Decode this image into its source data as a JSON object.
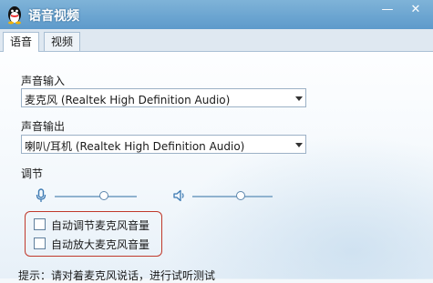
{
  "window": {
    "title": "语音视频",
    "minimize_glyph": "—",
    "close_glyph": "✕"
  },
  "tabs": [
    {
      "label": "语音",
      "active": true
    },
    {
      "label": "视频",
      "active": false
    }
  ],
  "audio_input": {
    "label": "声音输入",
    "device": "麦克风 (Realtek High Definition Audio)"
  },
  "audio_output": {
    "label": "声音输出",
    "device": "喇叭/耳机 (Realtek High Definition Audio)"
  },
  "adjust": {
    "label": "调节",
    "mic_volume_fraction": 0.6,
    "speaker_volume_fraction": 0.6
  },
  "options": [
    {
      "label": "自动调节麦克风音量",
      "checked": false
    },
    {
      "label": "自动放大麦克风音量",
      "checked": false
    }
  ],
  "hint": "提示：请对着麦克风说话，进行试听测试",
  "colors": {
    "titlebar": "#6aa3d2",
    "highlight_border": "#c0392b"
  }
}
